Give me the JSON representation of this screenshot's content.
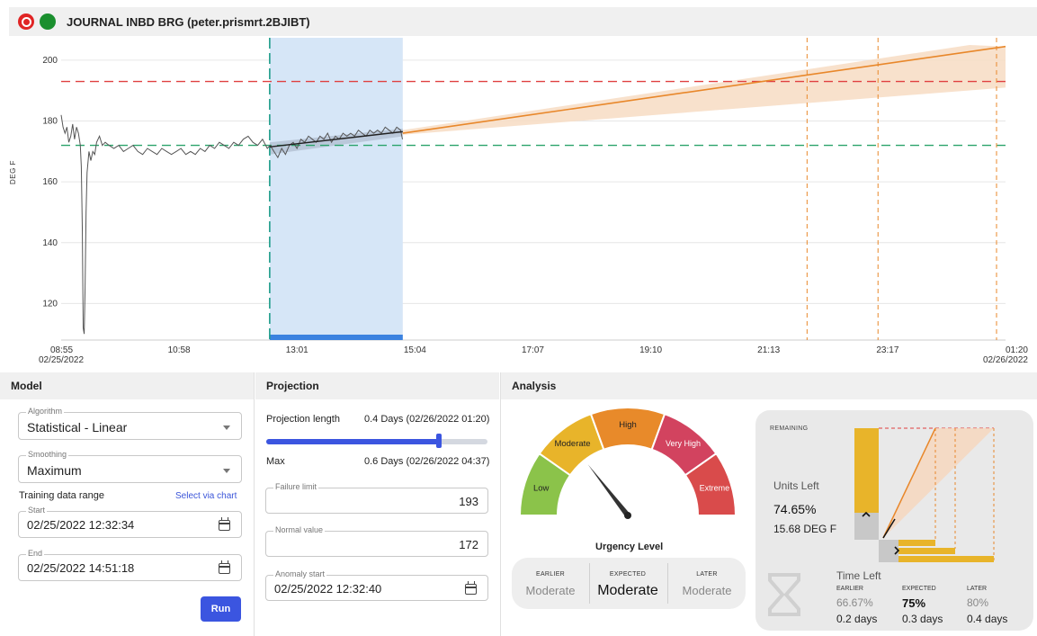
{
  "window": {
    "title": "JOURNAL INBD BRG (peter.prismrt.2BJIBT)"
  },
  "chart_data": {
    "type": "line",
    "ylabel": "DEG F",
    "ylim": [
      108,
      205
    ],
    "yticks": [
      120,
      140,
      160,
      180,
      200
    ],
    "xticks": [
      {
        "label": "08:55",
        "sub": "02/25/2022",
        "x": 0
      },
      {
        "label": "10:58",
        "sub": "",
        "x": 123
      },
      {
        "label": "13:01",
        "sub": "",
        "x": 246
      },
      {
        "label": "15:04",
        "sub": "",
        "x": 369
      },
      {
        "label": "17:07",
        "sub": "",
        "x": 492
      },
      {
        "label": "19:10",
        "sub": "",
        "x": 615
      },
      {
        "label": "21:13",
        "sub": "",
        "x": 738
      },
      {
        "label": "23:17",
        "sub": "",
        "x": 862
      },
      {
        "label": "01:20",
        "sub": "02/26/2022",
        "x": 985
      }
    ],
    "failure_limit": 193,
    "normal_value": 172,
    "training_range_minutes": [
      217.5,
      356.3
    ],
    "projection_end_minutes": 985,
    "expected_failure_minutes": [
      778,
      852,
      985
    ],
    "series": [
      {
        "values": [
          [
            0,
            182
          ],
          [
            2,
            178
          ],
          [
            4,
            176
          ],
          [
            6,
            178
          ],
          [
            8,
            173
          ],
          [
            10,
            175
          ],
          [
            12,
            179
          ],
          [
            14,
            174
          ],
          [
            16,
            178
          ],
          [
            18,
            176
          ],
          [
            20,
            172
          ],
          [
            21,
            165
          ],
          [
            22,
            145
          ],
          [
            23,
            112
          ],
          [
            24,
            110
          ],
          [
            25,
            125
          ],
          [
            26,
            150
          ],
          [
            27,
            163
          ],
          [
            29,
            170
          ],
          [
            31,
            167
          ],
          [
            33,
            170
          ],
          [
            35,
            169
          ],
          [
            37,
            173
          ],
          [
            40,
            175
          ],
          [
            43,
            172
          ],
          [
            46,
            173
          ],
          [
            50,
            172
          ],
          [
            55,
            171
          ],
          [
            60,
            172
          ],
          [
            65,
            170
          ],
          [
            70,
            171
          ],
          [
            75,
            172
          ],
          [
            80,
            170
          ],
          [
            85,
            169
          ],
          [
            90,
            171
          ],
          [
            95,
            170
          ],
          [
            100,
            169
          ],
          [
            105,
            171
          ],
          [
            110,
            170
          ],
          [
            115,
            169
          ],
          [
            120,
            170
          ],
          [
            125,
            171
          ],
          [
            130,
            169
          ],
          [
            135,
            170
          ],
          [
            140,
            169
          ],
          [
            145,
            171
          ],
          [
            150,
            170
          ],
          [
            155,
            172
          ],
          [
            160,
            171
          ],
          [
            165,
            173
          ],
          [
            170,
            172
          ],
          [
            175,
            171
          ],
          [
            180,
            173
          ],
          [
            185,
            172
          ],
          [
            190,
            174
          ],
          [
            195,
            175
          ],
          [
            200,
            173
          ],
          [
            205,
            172
          ],
          [
            210,
            174
          ],
          [
            215,
            171
          ],
          [
            218,
            172
          ],
          [
            222,
            170
          ],
          [
            226,
            168
          ],
          [
            230,
            171
          ],
          [
            234,
            169
          ],
          [
            238,
            172
          ],
          [
            242,
            173
          ],
          [
            246,
            171
          ],
          [
            250,
            174
          ],
          [
            254,
            173
          ],
          [
            258,
            175
          ],
          [
            262,
            174
          ],
          [
            266,
            173
          ],
          [
            270,
            175
          ],
          [
            274,
            174
          ],
          [
            278,
            176
          ],
          [
            282,
            173
          ],
          [
            286,
            175
          ],
          [
            290,
            174
          ],
          [
            294,
            176
          ],
          [
            298,
            175
          ],
          [
            302,
            176
          ],
          [
            306,
            175
          ],
          [
            310,
            177
          ],
          [
            314,
            176
          ],
          [
            318,
            175
          ],
          [
            322,
            177
          ],
          [
            326,
            176
          ],
          [
            330,
            177
          ],
          [
            334,
            176
          ],
          [
            338,
            178
          ],
          [
            342,
            177
          ],
          [
            346,
            176
          ],
          [
            350,
            178
          ],
          [
            354,
            177
          ],
          [
            356,
            174
          ]
        ]
      }
    ]
  },
  "panels": {
    "model": {
      "title": "Model",
      "algorithm_label": "Algorithm",
      "algorithm_value": "Statistical - Linear",
      "smoothing_label": "Smoothing",
      "smoothing_value": "Maximum",
      "training_label": "Training data range",
      "select_link": "Select via chart",
      "start_label": "Start",
      "start_value": "02/25/2022 12:32:34",
      "end_label": "End",
      "end_value": "02/25/2022 14:51:18",
      "run_label": "Run"
    },
    "projection": {
      "title": "Projection",
      "length_label": "Projection length",
      "length_value": "0.4 Days (02/26/2022 01:20)",
      "slider_fraction": 0.78,
      "max_label": "Max",
      "max_value": "0.6 Days (02/26/2022 04:37)",
      "failure_label": "Failure limit",
      "failure_value": "193",
      "normal_label": "Normal value",
      "normal_value": "172",
      "anomaly_label": "Anomaly start",
      "anomaly_value": "02/25/2022 12:32:40"
    },
    "analysis": {
      "title": "Analysis",
      "gauge_segments": [
        {
          "label": "Low",
          "color": "#8bc34a"
        },
        {
          "label": "Moderate",
          "color": "#e8b42a"
        },
        {
          "label": "High",
          "color": "#e88a2a"
        },
        {
          "label": "Very High",
          "color": "#d2435f"
        },
        {
          "label": "Extreme",
          "color": "#d94b4b"
        }
      ],
      "urgency_label": "Urgency Level",
      "earlier_label": "EARLIER",
      "earlier_value": "Moderate",
      "expected_label": "EXPECTED",
      "expected_value": "Moderate",
      "later_label": "LATER",
      "later_value": "Moderate",
      "remaining_label": "REMAINING",
      "units_left_label": "Units Left",
      "units_left_pct": "74.65%",
      "units_left_value": "15.68 DEG F",
      "time_left_label": "Time Left",
      "tl_earlier_label": "EARLIER",
      "tl_earlier_pct": "66.67%",
      "tl_earlier_days": "0.2 days",
      "tl_expected_label": "EXPECTED",
      "tl_expected_pct": "75%",
      "tl_expected_days": "0.3 days",
      "tl_later_label": "LATER",
      "tl_later_pct": "80%",
      "tl_later_days": "0.4 days"
    }
  },
  "colors": {
    "failure": "#e04040",
    "normal": "#2aa36b",
    "projection": "#e8872a",
    "training_band": "#d6e6f7",
    "training_bar": "#3b82e0",
    "anomaly_marker": "#1f9e8a",
    "data_line": "#555555"
  },
  "icons": [
    "app-logo-icon",
    "status-icon",
    "dropdown-caret-icon",
    "calendar-icon",
    "hourglass-icon"
  ]
}
